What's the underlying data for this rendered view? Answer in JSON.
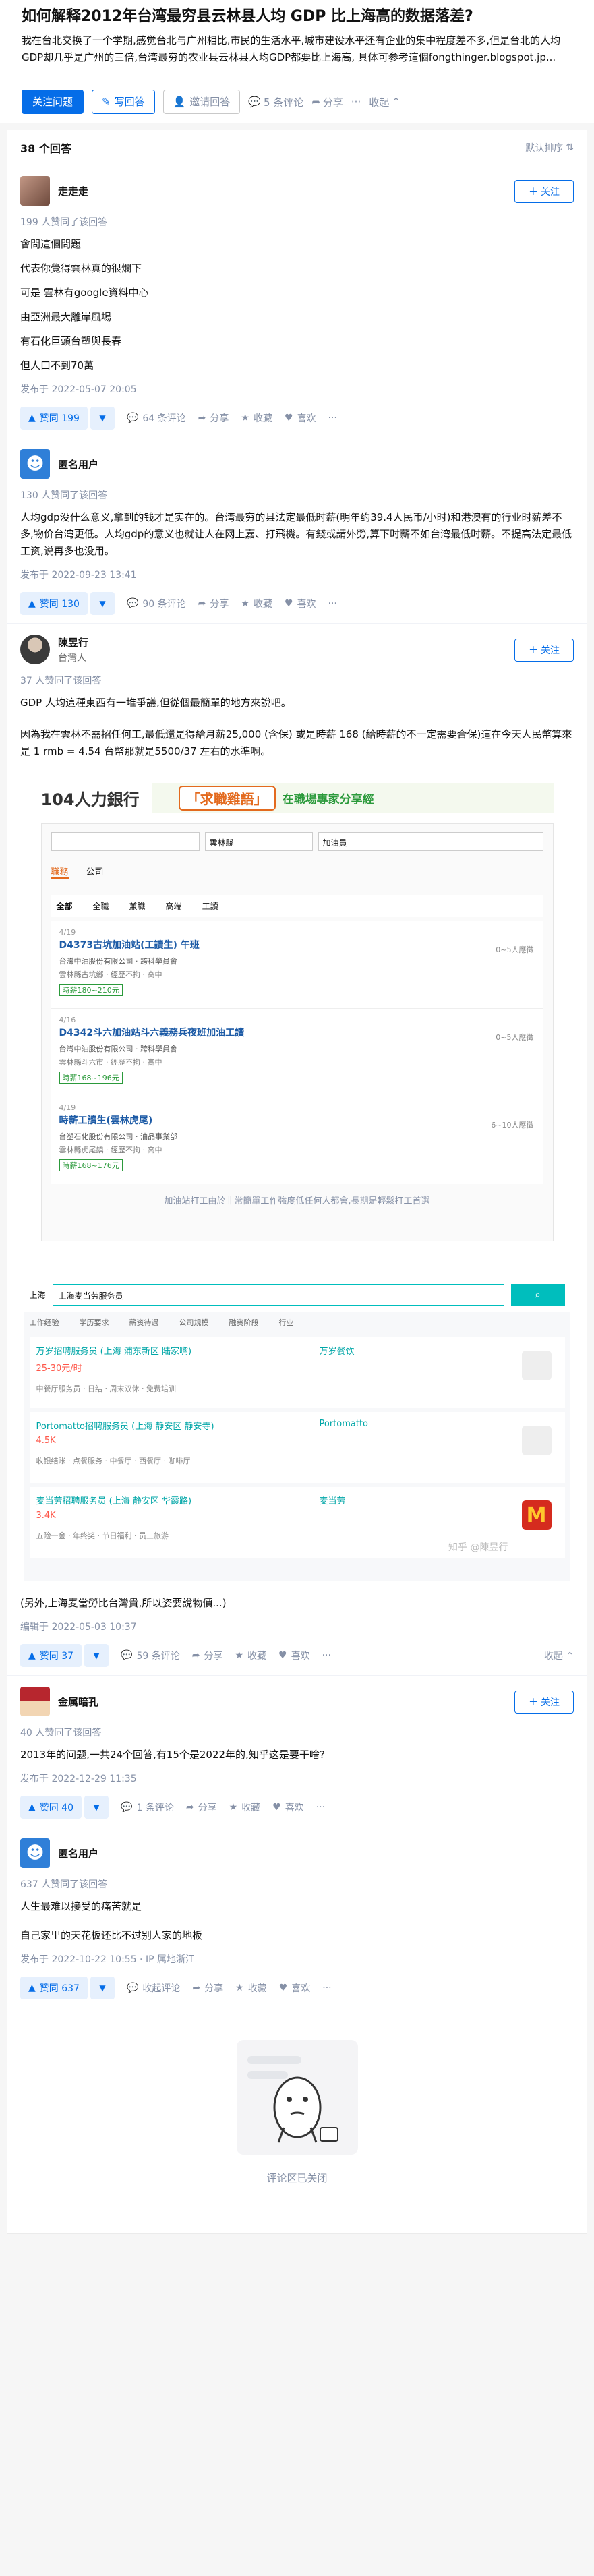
{
  "question": {
    "title": "如何解释2012年台湾最穷县云林县人均 GDP 比上海高的数据落差?",
    "description": "我在台北交换了一个学期,感觉台北与广州相比,市民的生活水平,城市建设水平还有企业的集中程度差不多,但是台北的人均GDP却几乎是广州的三倍,台湾最穷的农业县云林县人均GDP都要比上海高, 具体可参考這個fongthinger.blogspot.jp...",
    "actions": {
      "follow": "关注问题",
      "write": "写回答",
      "invite": "邀请回答",
      "comments": "5 条评论",
      "share": "分享",
      "fold": "收起"
    }
  },
  "answers_header": {
    "count": "38 个回答",
    "sort": "默认排序"
  },
  "common": {
    "follow_btn": "关注",
    "comment": "评论",
    "share": "分享",
    "favorite": "收藏",
    "like": "喜欢",
    "more": "···",
    "fold": "收起"
  },
  "answers": [
    {
      "name": "走走走",
      "votes_line": "199 人赞同了该回答",
      "paragraphs": [
        "會問這個問題",
        "代表你覺得雲林真的很爛下",
        "可是 雲林有google資料中心",
        "由亞洲最大離岸風場",
        "有石化巨頭台塑與長春",
        "但人口不到70萬"
      ],
      "time": "发布于 2022-05-07 20:05",
      "upvote": "赞同 199",
      "comments": "64 条评论"
    },
    {
      "name": "匿名用户",
      "votes_line": "130 人赞同了该回答",
      "paragraphs": [
        "人均gdp没什么意义,拿到的钱才是实在的。台湾最穷的县法定最低时薪(明年约39.4人民币/小时)和港澳有的行业时薪差不多,物价台湾更低。人均gdp的意义也就让人在网上嘉、打飛機。有錢或請外勞,算下时薪不如台湾最低时薪。不提高法定最低工资,说再多也没用。"
      ],
      "time": "发布于 2022-09-23 13:41",
      "upvote": "赞同 130",
      "comments": "90 条评论"
    },
    {
      "name": "陳昱行",
      "subtitle": "台灣人",
      "votes_line": "37 人赞同了该回答",
      "paragraphs": [
        "GDP 人均這種東西有一堆爭議,但從個最簡單的地方來說吧。",
        "因為我在雲林不需招任何工,最低還是得給月薪25,000 (含保) 或是時薪 168 (給時薪的不一定需要合保)這在今天人民幣算來是 1 rmb = 4.54 台幣那就是5500/37 左右的水準啊。"
      ],
      "after_paragraph": "(另外,上海麦當勞比台灣貴,所以姿要說物價...)",
      "time": "编辑于 2022-05-03 10:37",
      "upvote": "赞同 37",
      "comments": "59 条评论"
    },
    {
      "name": "金属暗孔",
      "votes_line": "40 人赞同了该回答",
      "paragraphs": [
        "2013年的问题,一共24个回答,有15个是2022年的,知乎这是要干啥?"
      ],
      "time": "发布于 2022-12-29 11:35",
      "upvote": "赞同 40",
      "comments": "1 条评论"
    },
    {
      "name": "匿名用户",
      "votes_line": "637 人赞同了该回答",
      "paragraphs": [
        "人生最难以接受的痛苦就是",
        "自己家里的天花板还比不过别人家的地板"
      ],
      "time": "发布于 2022-10-22 10:55 · IP 属地浙江",
      "upvote": "赞同 637",
      "comments": "收起评论"
    }
  ],
  "screenshot1": {
    "brand": "104人力銀行",
    "banner": "「求職雞語」",
    "banner_sub": "在職場專家分享經",
    "tabs": [
      "職務",
      "公司"
    ],
    "search_text": "雲林縣",
    "search_extra": "加油員",
    "filters": [
      "全部",
      "全職",
      "兼職",
      "高端",
      "工讀"
    ],
    "jobs": [
      {
        "date": "4/19",
        "title": "D4373古坑加油站(工讀生) 午班",
        "company": "台灣中油股份有限公司 · 跨科學員會",
        "info": "雲林縣古坑鄉 · 經歷不拘 · 高中",
        "salary": "時薪180~210元",
        "count": "0~5人應徵"
      },
      {
        "date": "4/16",
        "title": "D4342斗六加油站斗六義務兵夜班加油工讀",
        "company": "台灣中油股份有限公司 · 跨科學員會",
        "info": "雲林縣斗六市 · 經歷不拘 · 高中",
        "salary": "時薪168~196元",
        "count": "0~5人應徵"
      },
      {
        "date": "4/19",
        "title": "時薪工讀生(雲林虎尾)",
        "company": "台塑石化股份有限公司 · 油品事業部",
        "info": "雲林縣虎尾鎮 · 經歷不拘 · 高中",
        "salary": "時薪168~176元",
        "count": "6~10人應徵"
      }
    ],
    "caption": "加油站打工由於非常簡單工作強度低任何人都會,長期是輕鬆打工首選"
  },
  "screenshot2": {
    "city": "上海",
    "query": "上海麦当劳服务员",
    "filters": [
      "工作经验",
      "学历要求",
      "薪资待遇",
      "公司规模",
      "融资阶段",
      "行业"
    ],
    "jobs": [
      {
        "title": "万岁招聘服务员 (上海 浦东新区 陆家嘴)",
        "salary": "25-30元/时",
        "company": "万岁餐饮",
        "tags": "中餐厅服务员 · 日结 · 周末双休 · 免费培训",
        "logo": ""
      },
      {
        "title": "Portomatto招聘服务员 (上海 静安区 静安寺)",
        "salary": "4.5K",
        "company": "Portomatto",
        "tags": "收银结账 · 点餐服务 · 中餐厅 · 西餐厅 · 咖啡厅",
        "logo": ""
      },
      {
        "title": "麦当劳招聘服务员 (上海 静安区 华霞路)",
        "salary": "3.4K",
        "company": "麦当劳",
        "tags": "五险一金 · 年终奖 · 节日福利 · 员工旅游",
        "logo": "M"
      }
    ],
    "watermark": "知乎 @陳昱行"
  },
  "closed_tip": "评论区已关闭"
}
